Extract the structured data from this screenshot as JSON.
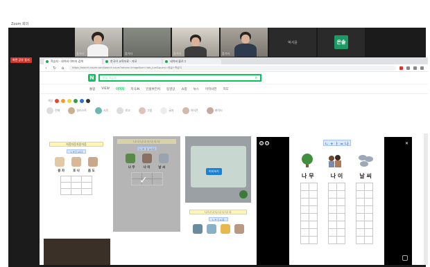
{
  "zoom": {
    "title": "Zoom 회의",
    "share_tag": "화면 공유 중지",
    "participants": [
      {
        "name": "참가자"
      },
      {
        "name": "참가자"
      },
      {
        "name": "참가자"
      },
      {
        "name": "참가자"
      },
      {
        "name": "박서윤"
      },
      {
        "name": "은솔"
      }
    ]
  },
  "browser": {
    "tabs": [
      {
        "label": "학습지 - 네이버 이미지 검색"
      },
      {
        "label": "한국어 교육자료 - 자모"
      },
      {
        "label": "네이버 블로그"
      }
    ],
    "url": "https://search.naver.com/search.naver?where=image&sm=tab_jum&query=한글+학습지"
  },
  "naver": {
    "logo": "N",
    "search_value": "한글 학습지",
    "tabs": [
      "통합",
      "VIEW",
      "이미지",
      "지식iN",
      "인플루언서",
      "동영상",
      "쇼핑",
      "뉴스",
      "어학사전",
      "지도"
    ],
    "active_tab": "이미지",
    "color_label": "색상",
    "colors": [
      "#e8412c",
      "#f29a2e",
      "#f4d33a",
      "#2e9e4a",
      "#2f6fd6",
      "#333333"
    ],
    "filters": [
      "전체",
      "일러스트",
      "사진",
      "로고",
      "그림",
      "글자",
      "아이콘",
      "캐릭터"
    ]
  },
  "sheet": {
    "title": "ㄴ + ㅏ = 나",
    "row_label": "ㄴ+ㅏ=나",
    "words": [
      {
        "syllables": [
          "나",
          "무"
        ]
      },
      {
        "syllables": [
          "나",
          "이"
        ]
      },
      {
        "syllables": [
          "날",
          "씨"
        ]
      }
    ],
    "small_words": [
      {
        "syllables": [
          "용",
          "자"
        ]
      },
      {
        "syllables": [
          "호",
          "나"
        ]
      },
      {
        "syllables": [
          "음",
          "도"
        ]
      }
    ],
    "preview_title": "나 나 나 나 나 나 나 나",
    "card3_label": "미리보기",
    "row3_title": "자음자음자음자음"
  }
}
